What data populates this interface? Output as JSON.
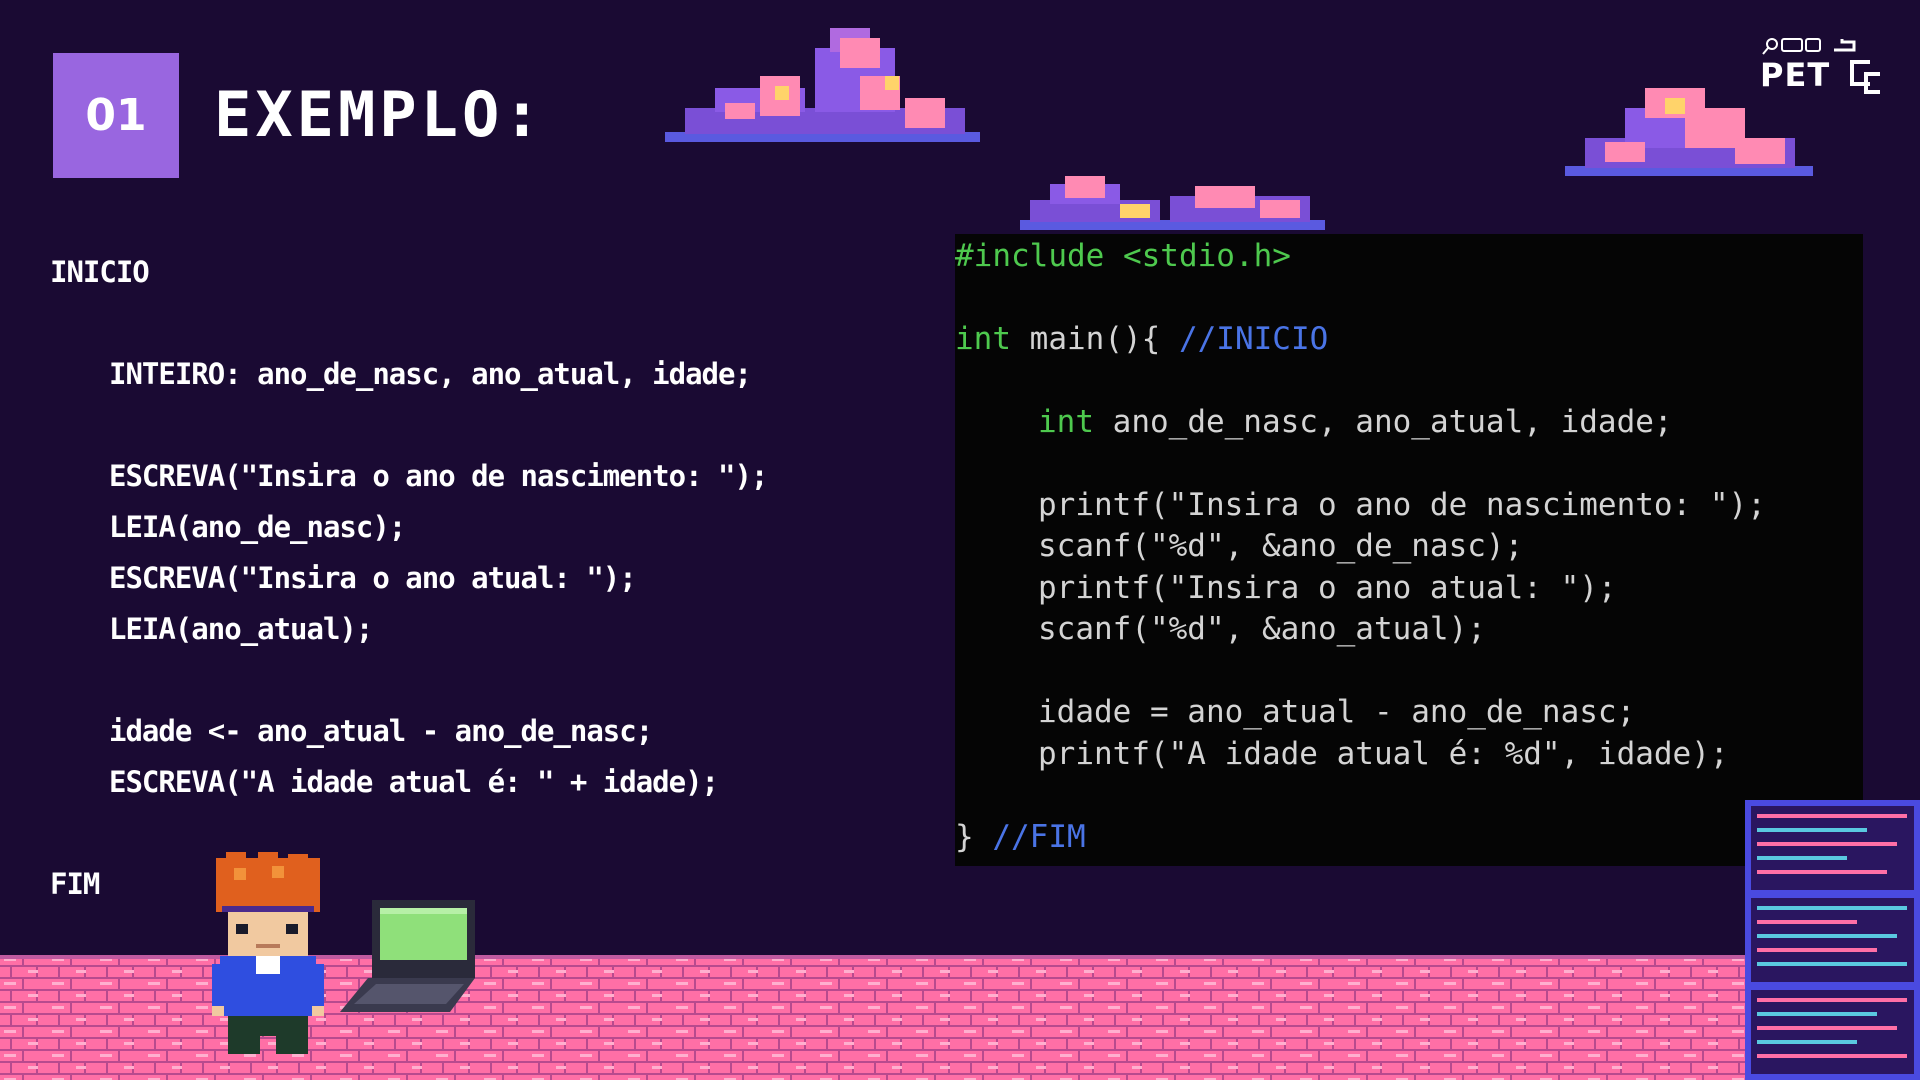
{
  "slide": {
    "number": "01",
    "title": "EXEMPLO:"
  },
  "logo": {
    "text": "PET",
    "mark": "CC"
  },
  "pseudocode": {
    "lines": [
      "INICIO",
      "INTEIRO: ano_de_nasc, ano_atual, idade;",
      "ESCREVA(\"Insira o ano de nascimento: \");",
      "LEIA(ano_de_nasc);",
      "ESCREVA(\"Insira o ano atual: \");",
      "LEIA(ano_atual);",
      "idade <- ano_atual - ano_de_nasc;",
      "ESCREVA(\"A idade atual é: \" + idade);",
      "FIM"
    ]
  },
  "code": {
    "include": "#include <stdio.h>",
    "main_kw": "int",
    "main_sig": " main(){ ",
    "main_comment": "//INICIO",
    "decl_kw": "int",
    "decl_rest": " ano_de_nasc, ano_atual, idade;",
    "printf1": "printf(\"Insira o ano de nascimento: \");",
    "scanf1": "scanf(\"%d\", &ano_de_nasc);",
    "printf2": "printf(\"Insira o ano atual: \");",
    "scanf2": "scanf(\"%d\", &ano_atual);",
    "calc": "idade = ano_atual - ano_de_nasc;",
    "printf3": "printf(\"A idade atual é: %d\", idade);",
    "close_brace": "} ",
    "close_comment": "//FIM"
  },
  "colors": {
    "background": "#1a0a33",
    "badge": "#9966e0",
    "keyword": "#4ec94e",
    "comment": "#4a74e6",
    "code_bg": "#050505"
  }
}
